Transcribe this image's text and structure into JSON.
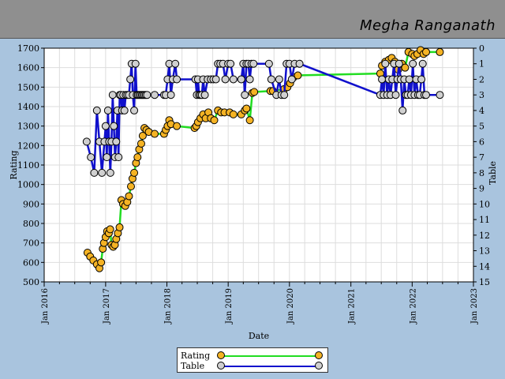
{
  "header": {
    "player_name": "Megha Ranganath"
  },
  "colors": {
    "background": "#a9c4de",
    "plot_bg": "#ffffff",
    "grid": "#dddddd",
    "rating_line": "#22dd22",
    "rating_marker": "#f5b324",
    "table_line": "#1010cc",
    "table_marker": "#d0d0d0"
  },
  "chart_data": {
    "type": "line",
    "xlabel": "Date",
    "ylabel": "Rating",
    "y2label": "Table",
    "xlim": [
      "2016-01-01",
      "2023-01-01"
    ],
    "ylim": [
      500,
      1700
    ],
    "y2lim": [
      0,
      15
    ],
    "y2_inverted": true,
    "x_tick_labels": [
      "Jan 2016",
      "Jan 2017",
      "Jan 2018",
      "Jan 2019",
      "Jan 2020",
      "Jan 2021",
      "Jan 2022",
      "Jan 2023"
    ],
    "y_tick_labels": [
      "500",
      "600",
      "700",
      "800",
      "900",
      "1000",
      "1100",
      "1200",
      "1300",
      "1400",
      "1500",
      "1600",
      "1700"
    ],
    "y2_tick_labels": [
      "0",
      "1",
      "2",
      "3",
      "4",
      "5",
      "6",
      "7",
      "8",
      "9",
      "10",
      "11",
      "12",
      "13",
      "14",
      "15"
    ],
    "grid": true,
    "legend_position": "bottom-center",
    "series": [
      {
        "name": "Rating",
        "axis": "left",
        "x": [
          "2016-09-15",
          "2016-10-01",
          "2016-10-20",
          "2016-11-10",
          "2016-11-25",
          "2016-12-05",
          "2016-12-15",
          "2016-12-22",
          "2017-01-01",
          "2017-01-10",
          "2017-01-20",
          "2017-01-28",
          "2017-02-05",
          "2017-02-15",
          "2017-02-25",
          "2017-03-05",
          "2017-03-15",
          "2017-03-25",
          "2017-04-05",
          "2017-04-15",
          "2017-04-28",
          "2017-05-10",
          "2017-05-20",
          "2017-06-01",
          "2017-06-10",
          "2017-06-20",
          "2017-07-01",
          "2017-07-10",
          "2017-07-20",
          "2017-08-01",
          "2017-08-10",
          "2017-08-20",
          "2017-09-01",
          "2017-09-15",
          "2017-10-20",
          "2017-12-15",
          "2017-12-25",
          "2018-01-05",
          "2018-01-15",
          "2018-01-25",
          "2018-03-01",
          "2018-06-15",
          "2018-06-25",
          "2018-07-05",
          "2018-07-20",
          "2018-08-05",
          "2018-08-20",
          "2018-09-05",
          "2018-09-20",
          "2018-10-10",
          "2018-11-01",
          "2018-11-20",
          "2018-12-10",
          "2019-01-10",
          "2019-02-01",
          "2019-03-20",
          "2019-04-10",
          "2019-04-20",
          "2019-05-10",
          "2019-05-25",
          "2019-06-05",
          "2019-09-10",
          "2019-09-25",
          "2019-12-01",
          "2019-12-20",
          "2020-01-05",
          "2020-01-25",
          "2020-02-20",
          "2021-06-25",
          "2021-07-05",
          "2021-07-25",
          "2021-08-15",
          "2021-09-01",
          "2021-09-20",
          "2021-10-10",
          "2021-11-01",
          "2021-11-20",
          "2021-12-10",
          "2022-01-01",
          "2022-01-15",
          "2022-02-01",
          "2022-02-20",
          "2022-03-10",
          "2022-03-25",
          "2022-06-15"
        ],
        "values": [
          650,
          630,
          610,
          590,
          570,
          600,
          670,
          700,
          730,
          760,
          750,
          770,
          690,
          680,
          690,
          720,
          750,
          780,
          920,
          900,
          890,
          910,
          940,
          990,
          1030,
          1060,
          1110,
          1140,
          1180,
          1210,
          1250,
          1290,
          1280,
          1270,
          1260,
          1260,
          1280,
          1300,
          1330,
          1310,
          1300,
          1290,
          1300,
          1320,
          1340,
          1360,
          1340,
          1370,
          1340,
          1330,
          1380,
          1370,
          1370,
          1370,
          1360,
          1360,
          1380,
          1390,
          1330,
          1470,
          1475,
          1480,
          1480,
          1490,
          1500,
          1520,
          1550,
          1560,
          1570,
          1610,
          1630,
          1640,
          1650,
          1630,
          1590,
          1620,
          1600,
          1680,
          1670,
          1660,
          1670,
          1690,
          1670,
          1680,
          1680
        ]
      },
      {
        "name": "Table",
        "axis": "right",
        "x": [
          "2016-09-10",
          "2016-10-05",
          "2016-10-25",
          "2016-11-10",
          "2016-11-25",
          "2016-12-10",
          "2016-12-25",
          "2017-01-01",
          "2017-01-08",
          "2017-01-15",
          "2017-01-22",
          "2017-01-29",
          "2017-02-05",
          "2017-02-12",
          "2017-02-19",
          "2017-02-26",
          "2017-03-05",
          "2017-03-12",
          "2017-03-19",
          "2017-03-26",
          "2017-04-02",
          "2017-04-09",
          "2017-04-16",
          "2017-04-23",
          "2017-05-01",
          "2017-05-10",
          "2017-05-20",
          "2017-05-28",
          "2017-06-05",
          "2017-06-12",
          "2017-06-20",
          "2017-06-28",
          "2017-07-05",
          "2017-07-12",
          "2017-07-20",
          "2017-07-28",
          "2017-08-05",
          "2017-08-12",
          "2017-08-20",
          "2017-08-28",
          "2017-09-05",
          "2017-10-20",
          "2017-12-15",
          "2017-12-25",
          "2018-01-05",
          "2018-01-15",
          "2018-01-25",
          "2018-02-05",
          "2018-02-20",
          "2018-03-01",
          "2018-06-20",
          "2018-06-28",
          "2018-07-05",
          "2018-07-12",
          "2018-07-20",
          "2018-07-28",
          "2018-08-05",
          "2018-08-15",
          "2018-09-01",
          "2018-09-20",
          "2018-10-05",
          "2018-10-20",
          "2018-11-01",
          "2018-11-15",
          "2018-12-01",
          "2018-12-15",
          "2019-01-01",
          "2019-01-15",
          "2019-02-01",
          "2019-03-20",
          "2019-04-01",
          "2019-04-10",
          "2019-04-20",
          "2019-05-01",
          "2019-05-10",
          "2019-05-20",
          "2019-06-01",
          "2019-09-01",
          "2019-09-15",
          "2019-10-15",
          "2019-11-01",
          "2019-11-15",
          "2019-12-01",
          "2019-12-15",
          "2020-01-01",
          "2020-01-15",
          "2020-02-01",
          "2020-03-01",
          "2021-06-25",
          "2021-07-05",
          "2021-07-15",
          "2021-07-25",
          "2021-08-05",
          "2021-08-15",
          "2021-08-25",
          "2021-09-05",
          "2021-09-15",
          "2021-09-25",
          "2021-10-05",
          "2021-10-15",
          "2021-10-25",
          "2021-11-05",
          "2021-11-15",
          "2021-11-25",
          "2021-12-05",
          "2021-12-15",
          "2021-12-25",
          "2022-01-05",
          "2022-01-15",
          "2022-01-25",
          "2022-02-05",
          "2022-02-15",
          "2022-02-25",
          "2022-03-05",
          "2022-03-15",
          "2022-03-25",
          "2022-06-15"
        ],
        "values": [
          6,
          7,
          8,
          4,
          6,
          8,
          6,
          5,
          7,
          4,
          6,
          8,
          6,
          3,
          5,
          7,
          6,
          4,
          7,
          3,
          3,
          4,
          3,
          4,
          3,
          3,
          3,
          2,
          1,
          3,
          4,
          1,
          3,
          3,
          3,
          3,
          3,
          3,
          3,
          3,
          3,
          3,
          3,
          3,
          2,
          1,
          3,
          2,
          1,
          2,
          2,
          3,
          2,
          3,
          3,
          3,
          2,
          3,
          2,
          2,
          2,
          2,
          1,
          1,
          1,
          2,
          1,
          1,
          2,
          2,
          1,
          3,
          1,
          1,
          2,
          1,
          1,
          1,
          2,
          3,
          2,
          3,
          3,
          1,
          1,
          2,
          1,
          1,
          3,
          2,
          3,
          1,
          3,
          2,
          3,
          2,
          1,
          3,
          2,
          1,
          2,
          4,
          2,
          3,
          3,
          2,
          3,
          1,
          3,
          2,
          3,
          3,
          2,
          1,
          3,
          3,
          3
        ]
      }
    ]
  }
}
